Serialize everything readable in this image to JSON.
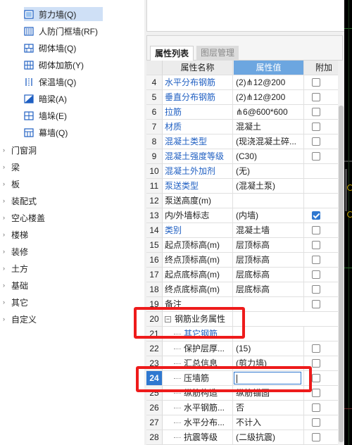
{
  "tree": {
    "wall_items": [
      {
        "label": "剪力墙(Q)",
        "icon": "shear-wall-icon",
        "selected": true
      },
      {
        "label": "人防门框墙(RF)",
        "icon": "civil-defense-door-frame-wall-icon",
        "selected": false
      },
      {
        "label": "砌体墙(Q)",
        "icon": "masonry-wall-icon",
        "selected": false
      },
      {
        "label": "砌体加筋(Y)",
        "icon": "masonry-reinforcement-icon",
        "selected": false
      },
      {
        "label": "保温墙(Q)",
        "icon": "insulation-wall-icon",
        "selected": false
      },
      {
        "label": "暗梁(A)",
        "icon": "hidden-beam-icon",
        "selected": false
      },
      {
        "label": "墙垛(E)",
        "icon": "wall-pier-icon",
        "selected": false
      },
      {
        "label": "幕墙(Q)",
        "icon": "curtain-wall-icon",
        "selected": false
      }
    ],
    "categories": [
      "门窗洞",
      "梁",
      "板",
      "装配式",
      "空心楼盖",
      "楼梯",
      "装修",
      "土方",
      "基础",
      "其它",
      "自定义"
    ]
  },
  "panel": {
    "tabs": [
      {
        "label": "属性列表",
        "active": true
      },
      {
        "label": "图层管理",
        "active": false
      }
    ],
    "headers": {
      "name": "属性名称",
      "value": "属性值",
      "extra": "附加"
    },
    "rows": [
      {
        "num": "4",
        "name": "水平分布钢筋",
        "value": "(2)⋔12@200",
        "blue": true,
        "checkbox": "unchecked"
      },
      {
        "num": "5",
        "name": "垂直分布钢筋",
        "value": "(2)⋔12@200",
        "blue": true,
        "checkbox": "unchecked"
      },
      {
        "num": "6",
        "name": "拉筋",
        "value": "⋔6@600*600",
        "blue": true,
        "checkbox": "unchecked"
      },
      {
        "num": "7",
        "name": "材质",
        "value": "混凝土",
        "blue": true,
        "checkbox": "unchecked"
      },
      {
        "num": "8",
        "name": "混凝土类型",
        "value": "(现浇混凝土碎...",
        "blue": true,
        "checkbox": "unchecked"
      },
      {
        "num": "9",
        "name": "混凝土强度等级",
        "value": "(C30)",
        "blue": true,
        "checkbox": "unchecked"
      },
      {
        "num": "10",
        "name": "混凝土外加剂",
        "value": "(无)",
        "blue": true,
        "checkbox": "none"
      },
      {
        "num": "11",
        "name": "泵送类型",
        "value": "(混凝土泵)",
        "blue": true,
        "checkbox": "none"
      },
      {
        "num": "12",
        "name": "泵送高度(m)",
        "value": "",
        "blue": false,
        "checkbox": "none"
      },
      {
        "num": "13",
        "name": "内/外墙标志",
        "value": "(内墙)",
        "blue": false,
        "checkbox": "checked"
      },
      {
        "num": "14",
        "name": "类别",
        "value": "混凝土墙",
        "blue": true,
        "checkbox": "unchecked"
      },
      {
        "num": "15",
        "name": "起点顶标高(m)",
        "value": "层顶标高",
        "blue": false,
        "checkbox": "unchecked"
      },
      {
        "num": "16",
        "name": "终点顶标高(m)",
        "value": "层顶标高",
        "blue": false,
        "checkbox": "unchecked"
      },
      {
        "num": "17",
        "name": "起点底标高(m)",
        "value": "层底标高",
        "blue": false,
        "checkbox": "unchecked"
      },
      {
        "num": "18",
        "name": "终点底标高(m)",
        "value": "层底标高",
        "blue": false,
        "checkbox": "unchecked"
      },
      {
        "num": "19",
        "name": "备注",
        "value": "",
        "blue": false,
        "checkbox": "unchecked"
      },
      {
        "num": "20",
        "name": "钢筋业务属性",
        "value": "",
        "blue": false,
        "checkbox": "none",
        "group": true
      },
      {
        "num": "21",
        "name": "其它钢筋",
        "value": "",
        "blue": true,
        "checkbox": "none",
        "indent": true
      },
      {
        "num": "22",
        "name": "保护层厚...",
        "value": "(15)",
        "blue": false,
        "checkbox": "unchecked",
        "indent": true
      },
      {
        "num": "23",
        "name": "汇总信息",
        "value": "(剪力墙)",
        "blue": false,
        "checkbox": "unchecked",
        "indent": true
      },
      {
        "num": "24",
        "name": "压墙筋",
        "value": "",
        "blue": false,
        "checkbox": "unchecked",
        "indent": true,
        "editing": true
      },
      {
        "num": "25",
        "name": "纵筋构造",
        "value": "纵筋锚固",
        "blue": false,
        "checkbox": "unchecked",
        "indent": true
      },
      {
        "num": "26",
        "name": "水平钢筋...",
        "value": "否",
        "blue": false,
        "checkbox": "unchecked",
        "indent": true
      },
      {
        "num": "27",
        "name": "水平分布...",
        "value": "不计入",
        "blue": false,
        "checkbox": "unchecked",
        "indent": true
      },
      {
        "num": "28",
        "name": "抗震等级",
        "value": "(二级抗震)",
        "blue": false,
        "checkbox": "unchecked",
        "indent": true
      }
    ]
  },
  "colors": {
    "annotation": "#ee1b1b",
    "selection": "#cfe0f6",
    "link_blue": "#1f5fc2",
    "header_value": "#6ca6e0"
  }
}
